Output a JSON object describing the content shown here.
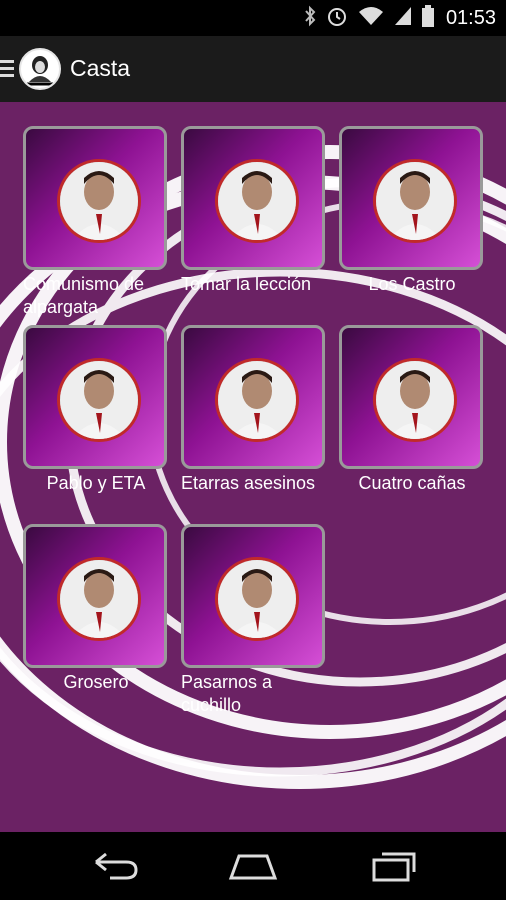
{
  "status": {
    "time": "01:53"
  },
  "actionbar": {
    "title": "Casta",
    "logo_icon": "podemos-logo-icon"
  },
  "tiles": [
    {
      "label": "Comunismo de alpargata"
    },
    {
      "label": "Tomar la lección"
    },
    {
      "label": "Los Castro"
    },
    {
      "label": "Pablo y ETA"
    },
    {
      "label": "Etarras asesinos"
    },
    {
      "label": "Cuatro cañas"
    },
    {
      "label": "Grosero"
    },
    {
      "label": "Pasarnos a cuchillo"
    }
  ],
  "nav": {
    "back_icon": "back-icon",
    "home_icon": "home-icon",
    "recents_icon": "recents-icon"
  }
}
